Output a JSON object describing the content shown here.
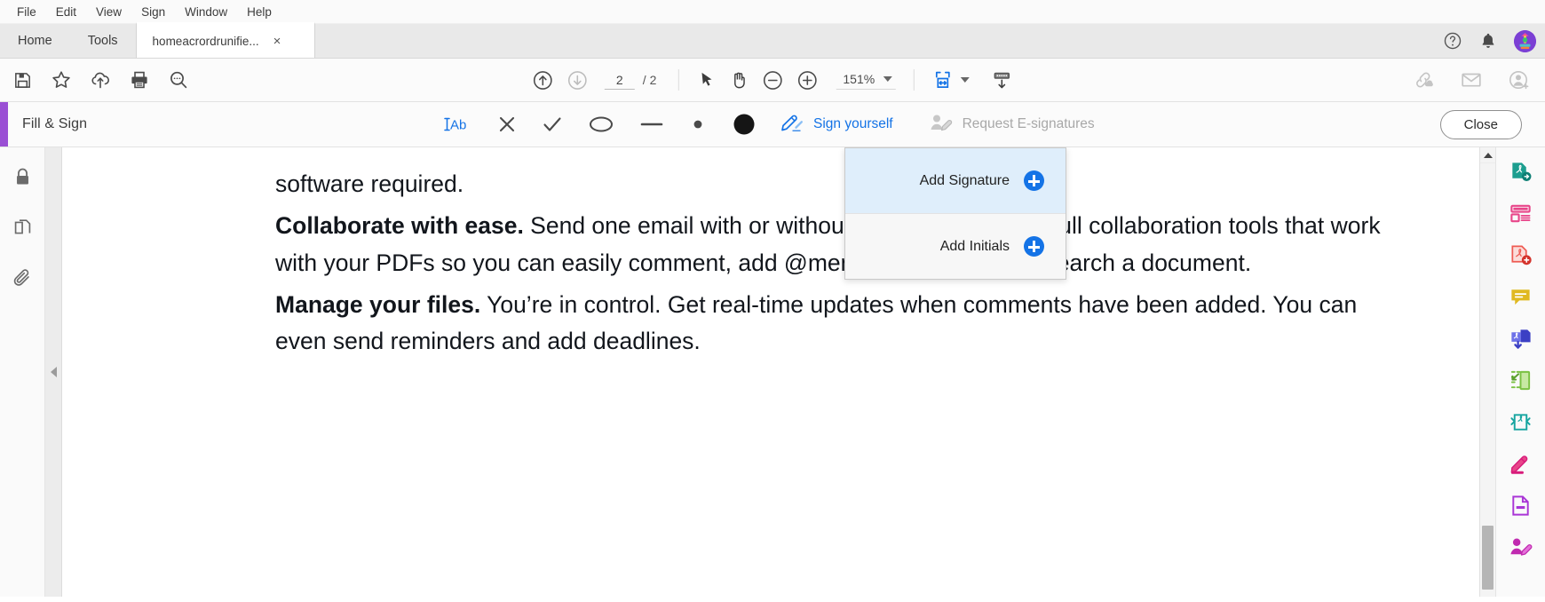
{
  "menubar": {
    "items": [
      {
        "label": "File"
      },
      {
        "label": "Edit"
      },
      {
        "label": "View"
      },
      {
        "label": "Sign"
      },
      {
        "label": "Window"
      },
      {
        "label": "Help"
      }
    ]
  },
  "tabs": {
    "home_label": "Home",
    "tools_label": "Tools",
    "document_title": "homeacrordrunifie...",
    "close_glyph": "×",
    "help_icon": "help-circle-icon",
    "bell_icon": "notification-bell-icon",
    "avatar_icon": "user-avatar"
  },
  "toolbar": {
    "save_icon": "save-floppy-icon",
    "star_icon": "add-to-favorites-star-icon",
    "upload_icon": "upload-to-cloud-icon",
    "print_icon": "print-icon",
    "search_icon": "search-icon",
    "prev_page_icon": "previous-page-icon",
    "next_page_icon": "next-page-icon",
    "page_current": "2",
    "page_total": "/ 2",
    "select_tool_icon": "select-cursor-icon",
    "hand_tool_icon": "hand-pan-icon",
    "zoom_out_icon": "zoom-out-icon",
    "zoom_in_icon": "zoom-in-icon",
    "zoom_level": "151%",
    "fit_page_icon": "fit-page-icon",
    "scroll_mode_icon": "scroll-mode-icon",
    "share_link_icon": "share-link-icon",
    "email_icon": "email-icon",
    "add_person_icon": "add-person-icon"
  },
  "fill_and_sign": {
    "title": "Fill & Sign",
    "tools": [
      {
        "name": "add-text-tool",
        "glyph": "IAb",
        "selected": true
      },
      {
        "name": "cross-mark-tool",
        "glyph": "✕",
        "selected": false
      },
      {
        "name": "check-mark-tool",
        "glyph": "✓",
        "selected": false
      },
      {
        "name": "ellipse-tool",
        "glyph": "ellipse",
        "selected": false
      },
      {
        "name": "line-tool",
        "glyph": "line",
        "selected": false
      },
      {
        "name": "dot-tool",
        "glyph": "dot",
        "selected": false
      },
      {
        "name": "color-swatch",
        "glyph": "filled-circle",
        "selected": false
      }
    ],
    "sign_yourself_label": "Sign yourself",
    "request_esignatures_label": "Request E-signatures",
    "close_label": "Close",
    "accent_color": "#9a4fd4",
    "active_color": "#1473e6",
    "disabled_color": "#a8a8a8"
  },
  "signature_menu": {
    "items": [
      {
        "label": "Add Signature",
        "highlighted": true
      },
      {
        "label": "Add Initials",
        "highlighted": false
      }
    ],
    "highlight_color": "#dfeefb",
    "plus_color": "#1473e6"
  },
  "left_rail": {
    "items": [
      {
        "name": "security-lock-icon"
      },
      {
        "name": "page-thumbnails-icon"
      },
      {
        "name": "attachments-paperclip-icon"
      }
    ],
    "collapse_icon": "collapse-panel-arrow-icon"
  },
  "right_rail": {
    "items": [
      {
        "name": "export-pdf-icon",
        "color": "#1c9e8f"
      },
      {
        "name": "organize-pages-icon",
        "color": "#e8468a"
      },
      {
        "name": "create-pdf-icon",
        "color": "#ee5a52"
      },
      {
        "name": "comment-icon",
        "color": "#e0b921"
      },
      {
        "name": "compress-pdf-icon",
        "color": "#4a4ed4"
      },
      {
        "name": "crop-pages-icon",
        "color": "#7ac143"
      },
      {
        "name": "protect-pdf-icon",
        "color": "#16a5a0"
      },
      {
        "name": "highlight-pen-icon",
        "color": "#d81b7a"
      },
      {
        "name": "edit-pdf-icon",
        "color": "#a935d6"
      },
      {
        "name": "request-signature-icon",
        "color": "#c02ab0"
      }
    ]
  },
  "document": {
    "paragraphs": [
      {
        "bold": "",
        "text": "software required."
      },
      {
        "bold": "Collaborate with ease.",
        "text": " Send one email with or without reviewers. Access full collaboration tools that work with your PDFs so you can easily comment, add @mentions, highlight, or search a document."
      },
      {
        "bold": "Manage your files.",
        "text": " You’re in control. Get real-time updates when comments have been added. You can even send reminders and add deadlines."
      }
    ]
  },
  "scrollbar": {
    "up_icon": "scroll-up-chevron-icon",
    "thumb": "scroll-thumb"
  }
}
